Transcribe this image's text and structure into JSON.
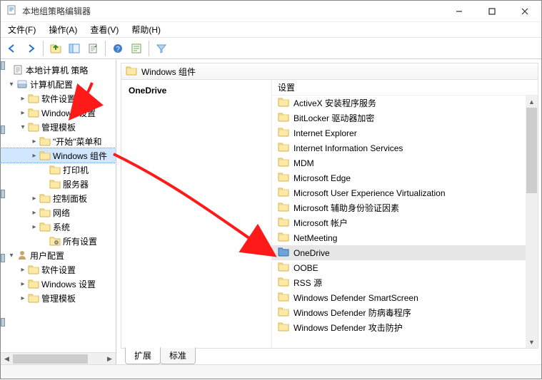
{
  "window": {
    "title": "本地组策略编辑器"
  },
  "menu": {
    "file": "文件(F)",
    "action": "操作(A)",
    "view": "查看(V)",
    "help": "帮助(H)"
  },
  "tree": {
    "root": "本地计算机 策略",
    "computer_config": "计算机配置",
    "software_settings": "软件设置",
    "windows_settings": "Windows 设置",
    "admin_templates": "管理模板",
    "start_menu_and": "\"开始\"菜单和",
    "windows_components": "Windows 组件",
    "printers": "打印机",
    "server": "服务器",
    "control_panel": "控制面板",
    "network": "网络",
    "system": "系统",
    "all_settings": "所有设置",
    "user_config": "用户配置",
    "u_software_settings": "软件设置",
    "u_windows_settings": "Windows 设置",
    "u_admin_templates": "管理模板"
  },
  "header": {
    "title": "Windows 组件"
  },
  "detail": {
    "heading": "OneDrive"
  },
  "column": {
    "settings": "设置"
  },
  "items": [
    "ActiveX 安装程序服务",
    "BitLocker 驱动器加密",
    "Internet Explorer",
    "Internet Information Services",
    "MDM",
    "Microsoft Edge",
    "Microsoft User Experience Virtualization",
    "Microsoft 辅助身份验证因素",
    "Microsoft 帐户",
    "NetMeeting",
    "OneDrive",
    "OOBE",
    "RSS 源",
    "Windows Defender SmartScreen",
    "Windows Defender 防病毒程序",
    "Windows Defender 攻击防护"
  ],
  "tabs": {
    "extended": "扩展",
    "standard": "标准"
  }
}
